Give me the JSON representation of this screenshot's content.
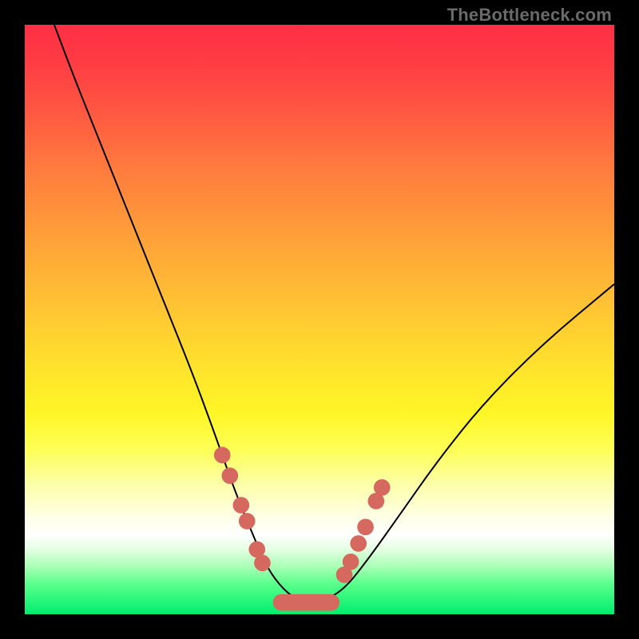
{
  "watermark": "TheBottleneck.com",
  "chart_data": {
    "type": "line",
    "title": "",
    "xlabel": "",
    "ylabel": "",
    "xlim": [
      0,
      100
    ],
    "ylim": [
      0,
      100
    ],
    "grid": false,
    "legend": false,
    "gradient_note": "background color maps y-value: red≈100, green≈0",
    "series": [
      {
        "name": "bottleneck-curve",
        "x": [
          5,
          8,
          12,
          16,
          20,
          24,
          28,
          31,
          33.5,
          36,
          38.5,
          41,
          44,
          47,
          50,
          54,
          58,
          63,
          70,
          78,
          88,
          100
        ],
        "y": [
          100,
          92,
          82,
          72,
          62,
          52,
          42,
          34,
          27,
          20,
          14,
          8,
          4,
          2,
          2,
          4,
          9,
          16,
          26,
          36,
          46,
          56
        ],
        "color": "#000000"
      }
    ],
    "markers": {
      "name": "highlight-points",
      "color": "#d5695f",
      "radius_percent": 1.4,
      "segment_x": [
        43.5,
        52.0
      ],
      "segment_y": 2,
      "points": [
        {
          "x": 33.5,
          "y": 27.0
        },
        {
          "x": 34.8,
          "y": 23.5
        },
        {
          "x": 36.7,
          "y": 18.5
        },
        {
          "x": 37.7,
          "y": 15.8
        },
        {
          "x": 39.4,
          "y": 11.0
        },
        {
          "x": 40.3,
          "y": 8.7
        },
        {
          "x": 54.2,
          "y": 6.7
        },
        {
          "x": 55.3,
          "y": 8.9
        },
        {
          "x": 56.6,
          "y": 12.0
        },
        {
          "x": 57.8,
          "y": 14.8
        },
        {
          "x": 59.6,
          "y": 19.2
        },
        {
          "x": 60.6,
          "y": 21.5
        }
      ]
    }
  }
}
